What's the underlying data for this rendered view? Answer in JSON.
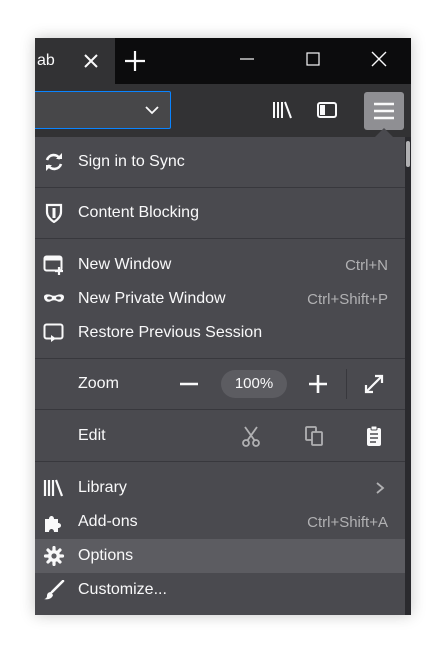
{
  "tab": {
    "label": "ab"
  },
  "menu": {
    "sync": {
      "label": "Sign in to Sync"
    },
    "content_blocking": {
      "label": "Content Blocking"
    },
    "new_window": {
      "label": "New Window",
      "shortcut": "Ctrl+N"
    },
    "new_private_window": {
      "label": "New Private Window",
      "shortcut": "Ctrl+Shift+P"
    },
    "restore_session": {
      "label": "Restore Previous Session"
    },
    "zoom": {
      "label": "Zoom",
      "value": "100%"
    },
    "edit": {
      "label": "Edit"
    },
    "library": {
      "label": "Library"
    },
    "addons": {
      "label": "Add-ons",
      "shortcut": "Ctrl+Shift+A"
    },
    "options": {
      "label": "Options"
    },
    "customize": {
      "label": "Customize..."
    }
  },
  "colors": {
    "tab_bar": "#0c0c0d",
    "toolbar": "#323234",
    "panel": "#4a4a4f",
    "highlight": "#5c5c61",
    "url_focus": "#0a84ff",
    "menu_button_active": "#8f8f93"
  }
}
